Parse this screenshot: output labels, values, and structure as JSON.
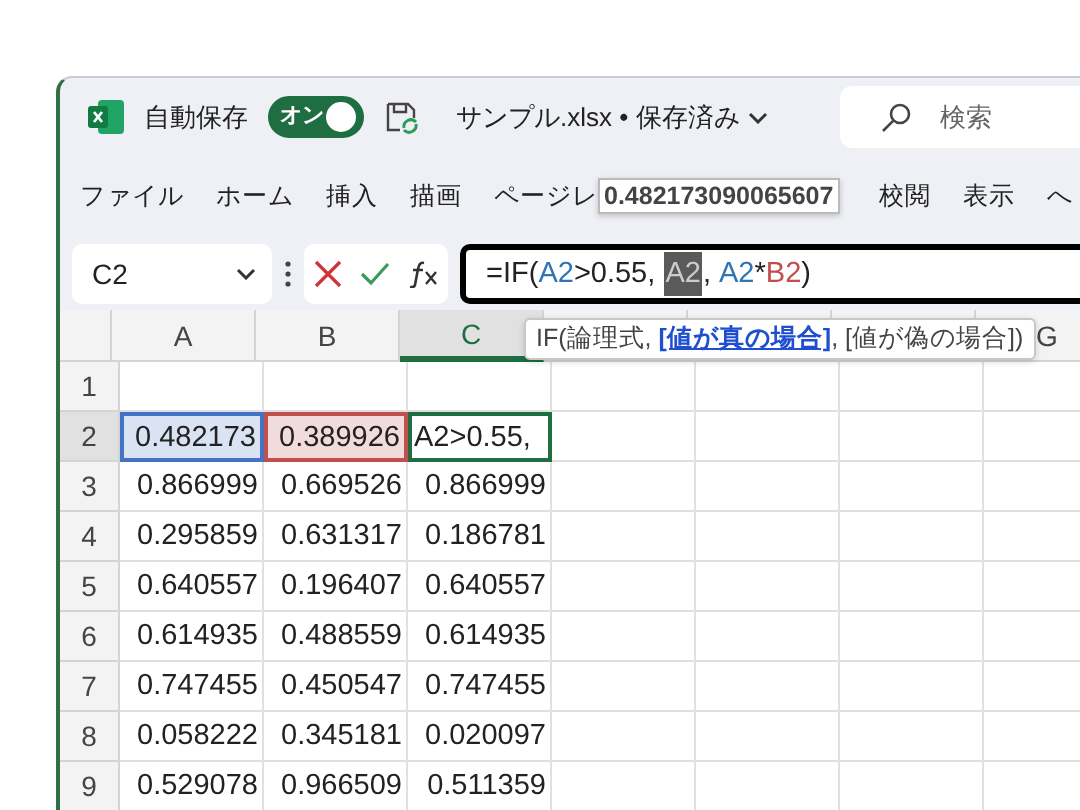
{
  "title_bar": {
    "autosave_label": "自動保存",
    "autosave": {
      "on": true,
      "label": "オン"
    },
    "file_title": "サンプル.xlsx • 保存済み",
    "search": {
      "placeholder": "検索"
    }
  },
  "ribbon": {
    "tabs_before": [
      "ファイル",
      "ホーム",
      "挿入",
      "描画",
      "ページレ"
    ],
    "value_tooltip": "0.482173090065607",
    "tabs_after": [
      "校閲",
      "表示",
      "へ"
    ]
  },
  "formula_bar": {
    "name_box": "C2",
    "formula": [
      {
        "kind": "text",
        "text": "=IF("
      },
      {
        "kind": "ref",
        "text": "A2",
        "color": "#2f75b5"
      },
      {
        "kind": "text",
        "text": ">0.55, "
      },
      {
        "kind": "selected",
        "text": "A2"
      },
      {
        "kind": "text",
        "text": ", "
      },
      {
        "kind": "ref",
        "text": "A2",
        "color": "#2f75b5"
      },
      {
        "kind": "text",
        "text": "*"
      },
      {
        "kind": "ref",
        "text": "B2",
        "color": "#c0504d"
      },
      {
        "kind": "text",
        "text": ")"
      }
    ]
  },
  "function_tooltip": {
    "prefix": "IF(",
    "separator": ", ",
    "suffix": ")",
    "args": [
      {
        "text": "論理式",
        "selected": false
      },
      {
        "text": "[値が真の場合]",
        "selected": true
      },
      {
        "text": "[値が偽の場合]",
        "selected": false
      }
    ]
  },
  "sheet": {
    "columns": [
      {
        "label": "A",
        "selected": false
      },
      {
        "label": "B",
        "selected": false
      },
      {
        "label": "C",
        "selected": true
      },
      {
        "selected": false
      },
      {
        "selected": false
      },
      {
        "selected": false
      },
      {
        "label": "G",
        "selected": false
      }
    ],
    "rows": [
      {
        "label": "1",
        "selected": false,
        "cells": []
      },
      {
        "label": "2",
        "selected": true,
        "cells": [
          {
            "kind": "ref",
            "text": "0.482173",
            "color": "#4472c4"
          },
          {
            "kind": "ref",
            "text": "0.389926",
            "color": "#c0504d"
          },
          {
            "kind": "editing",
            "text": "A2>0.55,"
          }
        ]
      },
      {
        "label": "3",
        "selected": false,
        "cells": [
          {
            "kind": "value",
            "text": "0.866999"
          },
          {
            "kind": "value",
            "text": "0.669526"
          },
          {
            "kind": "value",
            "text": "0.866999"
          }
        ]
      },
      {
        "label": "4",
        "selected": false,
        "cells": [
          {
            "kind": "value",
            "text": "0.295859"
          },
          {
            "kind": "value",
            "text": "0.631317"
          },
          {
            "kind": "value",
            "text": "0.186781"
          }
        ]
      },
      {
        "label": "5",
        "selected": false,
        "cells": [
          {
            "kind": "value",
            "text": "0.640557"
          },
          {
            "kind": "value",
            "text": "0.196407"
          },
          {
            "kind": "value",
            "text": "0.640557"
          }
        ]
      },
      {
        "label": "6",
        "selected": false,
        "cells": [
          {
            "kind": "value",
            "text": "0.614935"
          },
          {
            "kind": "value",
            "text": "0.488559"
          },
          {
            "kind": "value",
            "text": "0.614935"
          }
        ]
      },
      {
        "label": "7",
        "selected": false,
        "cells": [
          {
            "kind": "value",
            "text": "0.747455"
          },
          {
            "kind": "value",
            "text": "0.450547"
          },
          {
            "kind": "value",
            "text": "0.747455"
          }
        ]
      },
      {
        "label": "8",
        "selected": false,
        "cells": [
          {
            "kind": "value",
            "text": "0.058222"
          },
          {
            "kind": "value",
            "text": "0.345181"
          },
          {
            "kind": "value",
            "text": "0.020097"
          }
        ]
      },
      {
        "label": "9",
        "selected": false,
        "cells": [
          {
            "kind": "value",
            "text": "0.529078"
          },
          {
            "kind": "value",
            "text": "0.966509"
          },
          {
            "kind": "value",
            "text": "0.511359"
          }
        ]
      }
    ]
  }
}
